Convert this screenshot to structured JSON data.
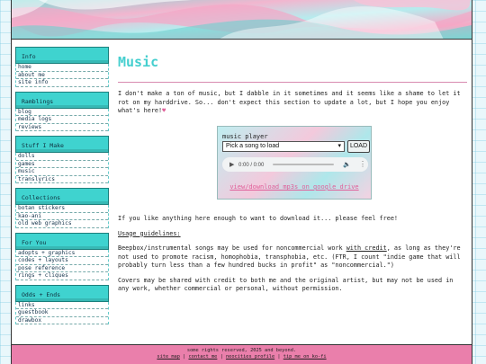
{
  "sidebar": {
    "sections": [
      {
        "title": "Info",
        "items": [
          "home",
          "about me",
          "site info"
        ]
      },
      {
        "title": "Ramblings",
        "items": [
          "blog",
          "media logs",
          "reviews"
        ]
      },
      {
        "title": "Stuff I Make",
        "items": [
          "dolls",
          "games",
          "music",
          "translyrics"
        ]
      },
      {
        "title": "Collections",
        "items": [
          "botan stickers",
          "kao-ani",
          "old web graphics"
        ]
      },
      {
        "title": "For You",
        "items": [
          "adopts + graphics",
          "codes + layouts",
          "pose reference",
          "rings + cliques"
        ]
      },
      {
        "title": "Odds + Ends",
        "items": [
          "links",
          "guestbook",
          "drawbox"
        ]
      }
    ]
  },
  "main": {
    "title": "Music",
    "intro": "I don't make a ton of music, but I dabble in it sometimes and it seems like a shame to let it rot on my harddrive. So... don't expect this section to update a lot, but I hope you enjoy what's here!",
    "intro_heart": "♥",
    "player": {
      "label": "music player",
      "select_value": "Pick a song to load",
      "load_label": "LOAD",
      "time": "0:00 / 0:00",
      "link_text": "view/download mp3s on google drive"
    },
    "download_text": "If you like anything here enough to want to download it... please feel free!",
    "guidelines_heading": "Usage guidelines:",
    "para1_a": "Beepbox/instrumental songs may be used for noncommercial work ",
    "para1_link": "with credit",
    "para1_b": ", as long as they're not used to promote racism, homophobia, transphobia, etc. (FTR, I count \"indie game that will probably turn less than a few hundred bucks in profit\" as \"noncommercial.\")",
    "para2": "Covers may be shared with credit to both me and the original artist, but may not be used in any work, whether commercial or personal, without permission."
  },
  "footer": {
    "line1": "some rights reserved, 2025 and beyond.",
    "links": [
      "site map",
      "contact me",
      "neocities profile",
      "tip me on ko-fi"
    ],
    "separator": " | "
  }
}
